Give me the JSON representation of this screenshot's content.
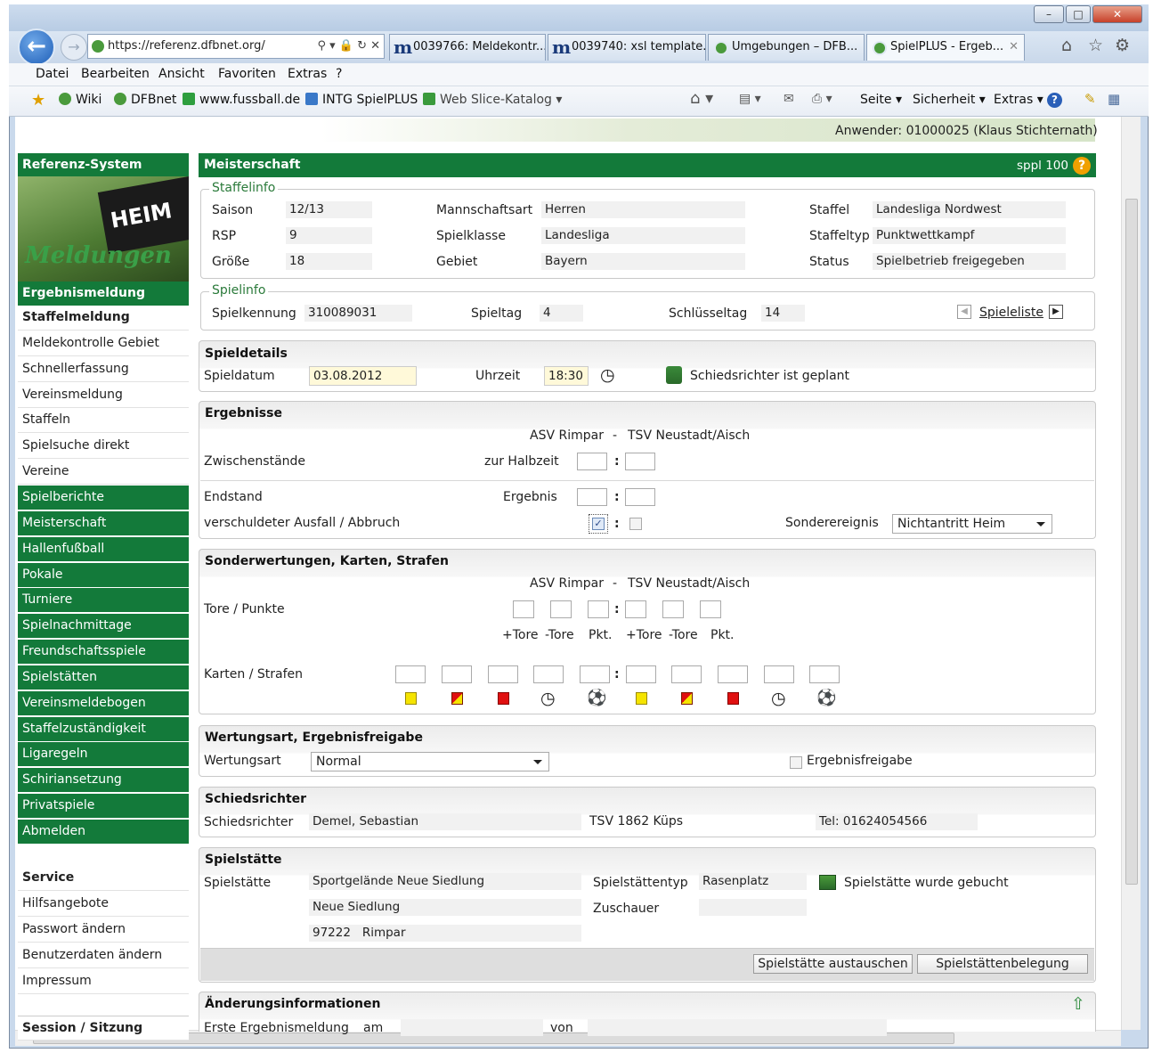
{
  "browser": {
    "url": "https://referenz.dfbnet.org/",
    "tabs": [
      {
        "label": "0039766: Meldekontr..."
      },
      {
        "label": "0039740: xsl template..."
      },
      {
        "label": "Umgebungen – DFB..."
      },
      {
        "label": "SpielPLUS - Ergeb..."
      }
    ],
    "menu": [
      "Datei",
      "Bearbeiten",
      "Ansicht",
      "Favoriten",
      "Extras",
      "?"
    ],
    "favorites": [
      "Wiki",
      "DFBnet",
      "www.fussball.de",
      "INTG SpielPLUS",
      "Web Slice-Katalog"
    ],
    "tools": [
      "Seite",
      "Sicherheit",
      "Extras"
    ]
  },
  "header": {
    "user": "Anwender: 01000025 (Klaus Stichternath)"
  },
  "sidebar": {
    "title": "Referenz-System",
    "banner_heim": "HEIM",
    "banner_text": "Meldungen",
    "items": [
      {
        "label": "Ergebnismeldung"
      },
      {
        "label": "Staffelmeldung"
      },
      {
        "label": "Meldekontrolle Gebiet"
      },
      {
        "label": "Schnellerfassung"
      },
      {
        "label": "Vereinsmeldung"
      },
      {
        "label": "Staffeln"
      },
      {
        "label": "Spielsuche direkt"
      },
      {
        "label": "Vereine"
      },
      {
        "label": "Spielberichte"
      },
      {
        "label": "Meisterschaft"
      },
      {
        "label": "Hallenfußball"
      },
      {
        "label": "Pokale"
      },
      {
        "label": "Turniere"
      },
      {
        "label": "Spielnachmittage"
      },
      {
        "label": "Freundschaftsspiele"
      },
      {
        "label": "Spielstätten"
      },
      {
        "label": "Vereinsmeldebogen"
      },
      {
        "label": "Staffelzuständigkeit"
      },
      {
        "label": "Ligaregeln"
      },
      {
        "label": "Schiriansetzung"
      },
      {
        "label": "Privatspiele"
      },
      {
        "label": "Abmelden"
      }
    ],
    "service_title": "Service",
    "service": [
      {
        "label": "Hilfsangebote"
      },
      {
        "label": "Passwort ändern"
      },
      {
        "label": "Benutzerdaten ändern"
      },
      {
        "label": "Impressum"
      }
    ],
    "session_title": "Session / Sitzung"
  },
  "main": {
    "title": "Meisterschaft",
    "code": "sppl 100",
    "staffelinfo": {
      "legend": "Staffelinfo",
      "saison_label": "Saison",
      "saison": "12/13",
      "rsp_label": "RSP",
      "rsp": "9",
      "groesse_label": "Größe",
      "groesse": "18",
      "mannschaftsart_label": "Mannschaftsart",
      "mannschaftsart": "Herren",
      "spielklasse_label": "Spielklasse",
      "spielklasse": "Landesliga",
      "gebiet_label": "Gebiet",
      "gebiet": "Bayern",
      "staffel_label": "Staffel",
      "staffel": "Landesliga Nordwest",
      "staffeltyp_label": "Staffeltyp",
      "staffeltyp": "Punktwettkampf",
      "status_label": "Status",
      "status": "Spielbetrieb freigegeben"
    },
    "spielinfo": {
      "legend": "Spielinfo",
      "kennung_label": "Spielkennung",
      "kennung": "310089031",
      "spieltag_label": "Spieltag",
      "spieltag": "4",
      "schluessel_label": "Schlüsseltag",
      "schluessel": "14",
      "liste_link": "Spieleliste"
    },
    "spieldetails": {
      "title": "Spieldetails",
      "datum_label": "Spieldatum",
      "datum": "03.08.2012",
      "uhrzeit_label": "Uhrzeit",
      "uhrzeit": "18:30",
      "schiri_text": "Schiedsrichter ist geplant"
    },
    "ergebnisse": {
      "title": "Ergebnisse",
      "home": "ASV Rimpar",
      "sep": "-",
      "away": "TSV Neustadt/Aisch",
      "zwischen_label": "Zwischenstände",
      "halbzeit_label": "zur Halbzeit",
      "endstand_label": "Endstand",
      "ergebnis_label": "Ergebnis",
      "ausfall_label": "verschuldeter Ausfall / Abbruch",
      "sonder_label": "Sonderereignis",
      "sonder_value": "Nichtantritt Heim",
      "colon": ":"
    },
    "sonderwertungen": {
      "title": "Sonderwertungen, Karten, Strafen",
      "home": "ASV Rimpar",
      "sep": "-",
      "away": "TSV Neustadt/Aisch",
      "tore_label": "Tore / Punkte",
      "col_plus": "+Tore",
      "col_minus": "-Tore",
      "col_pkt": "Pkt.",
      "karten_label": "Karten / Strafen",
      "colon": ":"
    },
    "wertung": {
      "title": "Wertungsart, Ergebnisfreigabe",
      "art_label": "Wertungsart",
      "art_value": "Normal",
      "freigabe_label": "Ergebnisfreigabe"
    },
    "schiedsrichter": {
      "title": "Schiedsrichter",
      "label": "Schiedsrichter",
      "name": "Demel, Sebastian",
      "verein": "TSV 1862 Küps",
      "tel": "Tel: 01624054566"
    },
    "spielstaette": {
      "title": "Spielstätte",
      "label": "Spielstätte",
      "name": "Sportgelände Neue Siedlung",
      "street": "Neue Siedlung",
      "plz": "97222",
      "ort": "Rimpar",
      "typ_label": "Spielstättentyp",
      "typ": "Rasenplatz",
      "zuschauer_label": "Zuschauer",
      "gebucht_text": "Spielstätte wurde gebucht",
      "btn_austauschen": "Spielstätte austauschen",
      "btn_belegung": "Spielstättenbelegung"
    },
    "aenderung": {
      "title": "Änderungsinformationen",
      "erste_label": "Erste Ergebnismeldung",
      "am_label": "am",
      "von_label": "von"
    }
  },
  "colors": {
    "brand_green": "#137a3a",
    "accent_orange": "#f0a000"
  }
}
